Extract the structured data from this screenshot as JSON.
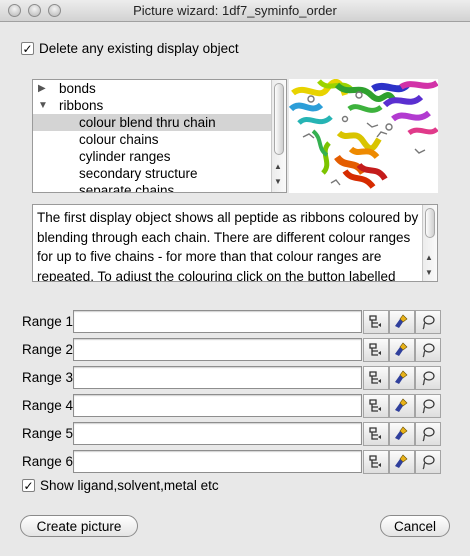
{
  "window": {
    "title": "Picture wizard: 1df7_syminfo_order",
    "controls": [
      "close-button",
      "minimize-button",
      "zoom-button"
    ]
  },
  "delete_existing": {
    "label": "Delete any existing display object",
    "checked": true
  },
  "tree": {
    "items": [
      {
        "label": "bonds",
        "expanded": false,
        "level": 0
      },
      {
        "label": "ribbons",
        "expanded": true,
        "level": 0
      },
      {
        "label": "colour blend thru chain",
        "level": 1,
        "selected": true
      },
      {
        "label": "colour chains",
        "level": 1
      },
      {
        "label": "cylinder ranges",
        "level": 1
      },
      {
        "label": "secondary structure",
        "level": 1
      },
      {
        "label": "separate chains",
        "level": 1
      }
    ]
  },
  "description": "The first display object shows all peptide as ribbons coloured by blending through each chain. There are different colour ranges for up to five chains - for more than that colour ranges are repeated. To adjust the colouring click on the button labelled 'Blend' then modify or load the",
  "ranges": [
    {
      "label": "Range 1",
      "value": ""
    },
    {
      "label": "Range 2",
      "value": ""
    },
    {
      "label": "Range 3",
      "value": ""
    },
    {
      "label": "Range 4",
      "value": ""
    },
    {
      "label": "Range 5",
      "value": ""
    },
    {
      "label": "Range 6",
      "value": ""
    }
  ],
  "range_tool_icons": [
    "selection-browser-icon",
    "paint-brush-icon",
    "lasso-icon"
  ],
  "show_ligand": {
    "label": "Show ligand,solvent,metal etc",
    "checked": true
  },
  "buttons": {
    "create": "Create picture",
    "cancel": "Cancel"
  },
  "colors": {
    "window_bg": "#e8e8e8",
    "selection_bg": "#d4d4d4",
    "brush_handle": "#e8b21a",
    "brush_tip": "#2f3f9c"
  }
}
